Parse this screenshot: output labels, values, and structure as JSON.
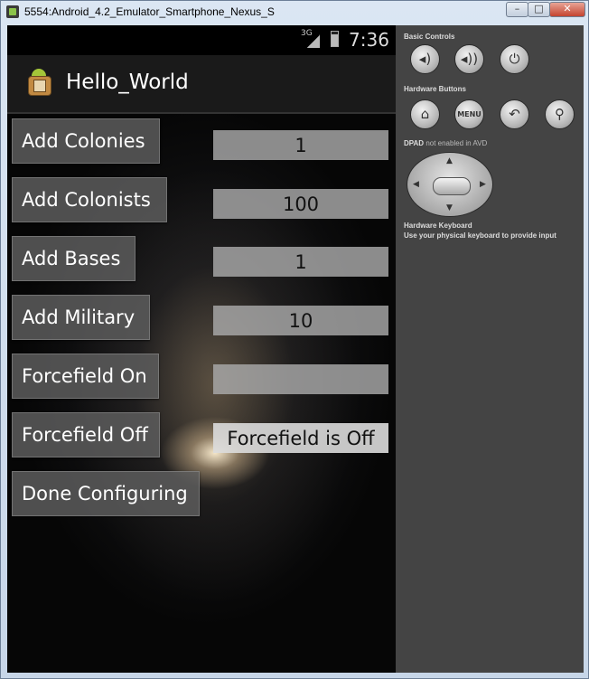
{
  "window": {
    "title": "5554:Android_4.2_Emulator_Smartphone_Nexus_S",
    "min_label": "–",
    "max_label": "□",
    "close_label": "✕"
  },
  "statusbar": {
    "network": "3G",
    "time": "7:36"
  },
  "app": {
    "title": "Hello_World"
  },
  "rows": [
    {
      "button": "Add Colonies",
      "value": "1"
    },
    {
      "button": "Add Colonists",
      "value": "100"
    },
    {
      "button": "Add Bases",
      "value": "1"
    },
    {
      "button": "Add Military",
      "value": "10"
    },
    {
      "button": "Forcefield On",
      "value": ""
    },
    {
      "button": "Forcefield Off",
      "value": "Forcefield is Off"
    },
    {
      "button": "Done Configuring"
    }
  ],
  "panel": {
    "basic_controls": "Basic Controls",
    "hardware_buttons": "Hardware Buttons",
    "menu_label": "MENU",
    "dpad_prefix": "DPAD",
    "dpad_note": "not enabled in AVD",
    "keyboard_title": "Hardware Keyboard",
    "keyboard_note": "Use your physical keyboard to provide input"
  }
}
